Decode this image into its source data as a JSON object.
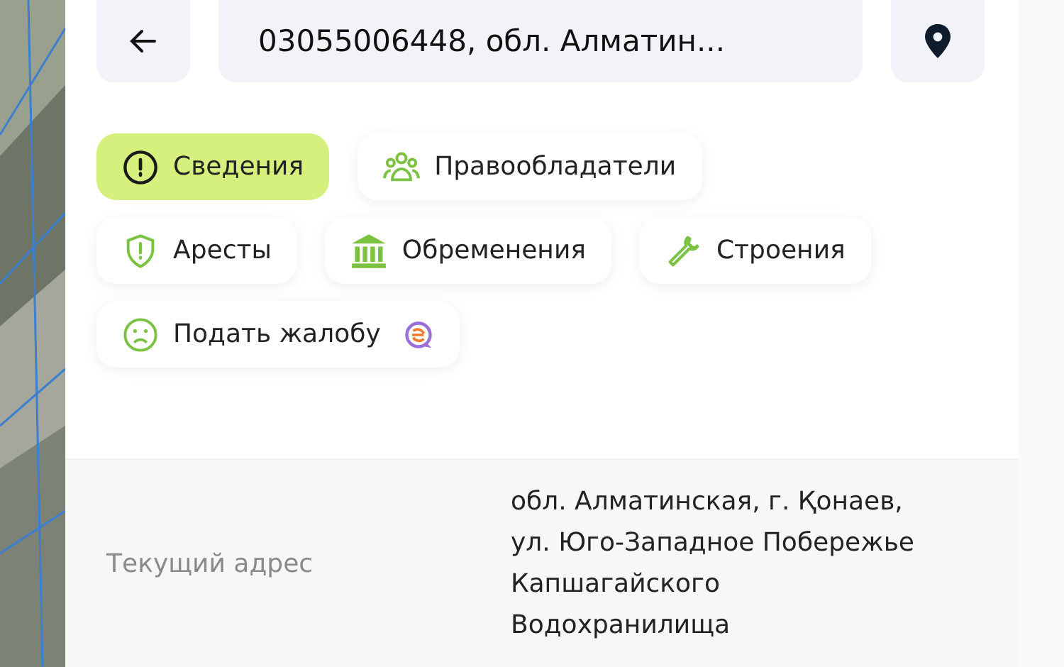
{
  "header": {
    "query": "03055006448, обл. Алматин..."
  },
  "tabs": [
    {
      "label": "Сведения",
      "kind": "info",
      "selected": true
    },
    {
      "label": "Правообладатели",
      "kind": "people",
      "selected": false
    },
    {
      "label": "Аресты",
      "kind": "shield",
      "selected": false
    },
    {
      "label": "Обременения",
      "kind": "bank",
      "selected": false
    },
    {
      "label": "Строения",
      "kind": "wrench",
      "selected": false
    },
    {
      "label": "Подать жалобу",
      "kind": "sad",
      "selected": false,
      "badge": true
    }
  ],
  "rows": [
    {
      "label": "Текущий адрес",
      "value": "обл. Алматинская, г. Қонаев, ул. Юго-Западное Побережье Капшагайского Водохранилища"
    }
  ]
}
